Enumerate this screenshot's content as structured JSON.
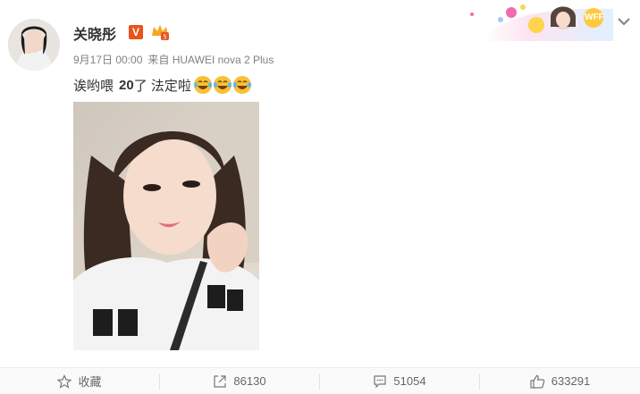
{
  "post": {
    "author": "关晓彤",
    "verified_badge": "V",
    "date": "9月17日 00:00",
    "source": "来自 HUAWEI nova 2 Plus",
    "text_plain": "诶哟喂",
    "text_bold": "20",
    "text_tail": "了 法定啦",
    "emoji": [
      "laugh-cry-emoji",
      "laugh-cry-emoji",
      "laugh-cry-emoji"
    ],
    "banner_text": "WFF"
  },
  "actions": {
    "favorite_label": "收藏",
    "repost_count": "86130",
    "comment_count": "51054",
    "like_count": "633291"
  },
  "colors": {
    "accent_orange": "#e8541e",
    "text_dark": "#333333",
    "text_gray": "#808080",
    "emoji_yellow": "#f7c136"
  }
}
